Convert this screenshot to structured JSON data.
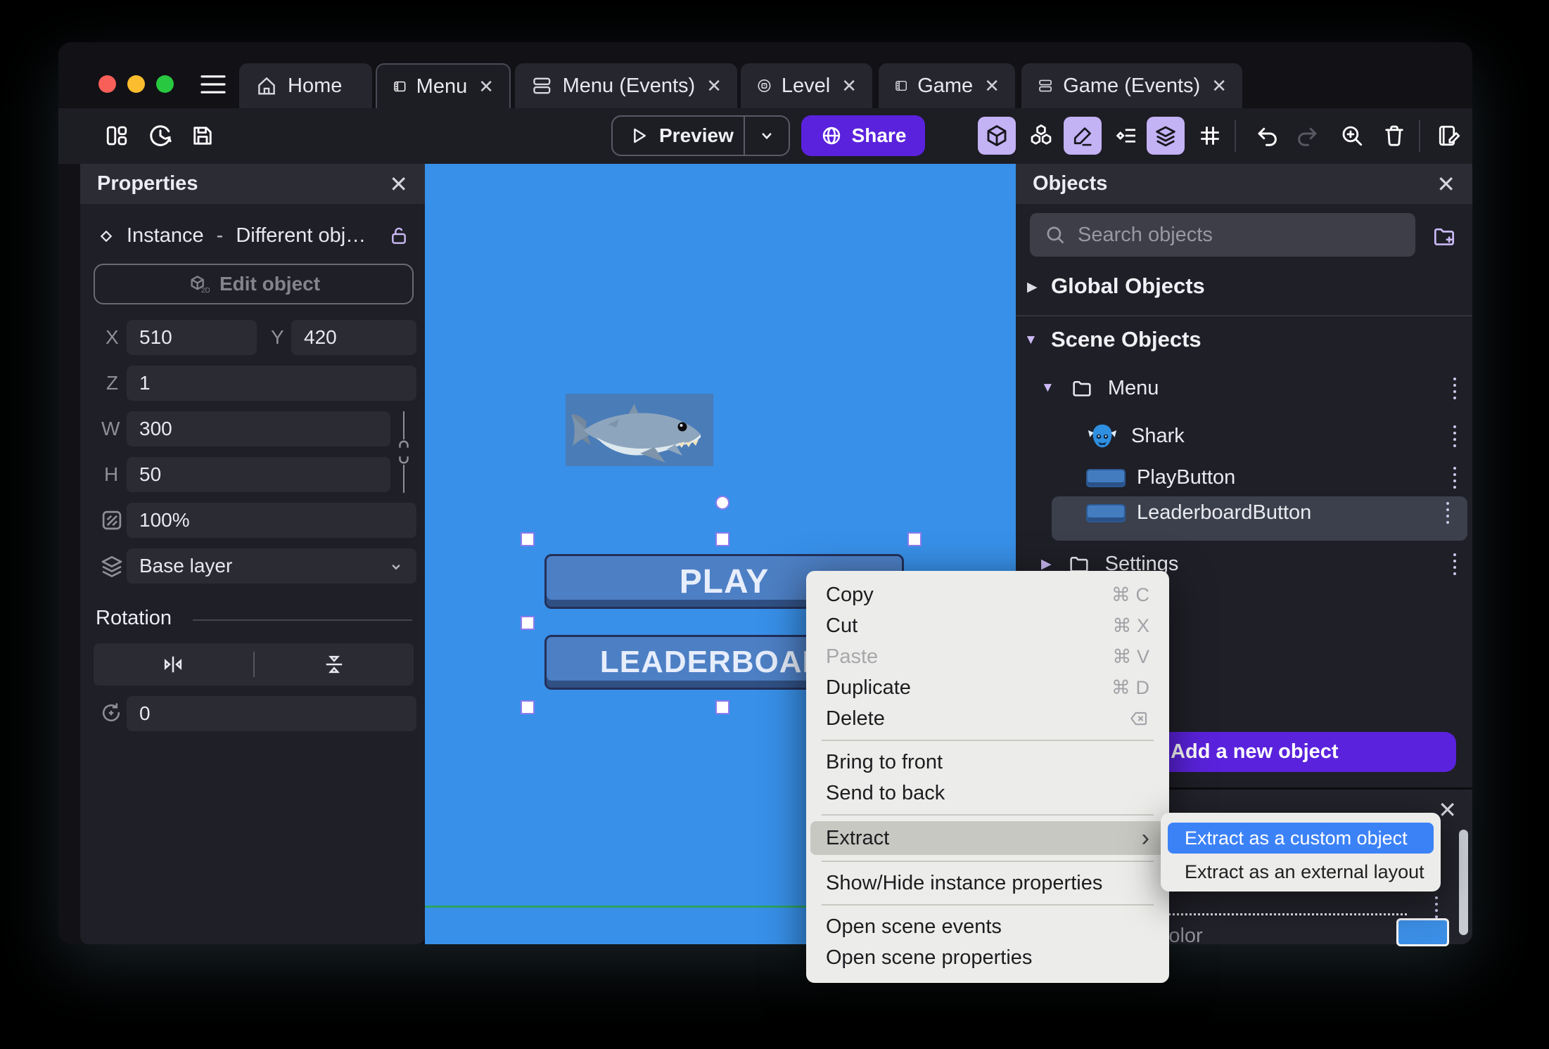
{
  "tabs": [
    {
      "label": "Home",
      "icon": "home",
      "closable": false,
      "active": false
    },
    {
      "label": "Menu",
      "icon": "scene",
      "closable": true,
      "active": true
    },
    {
      "label": "Menu (Events)",
      "icon": "events",
      "closable": true,
      "active": false
    },
    {
      "label": "Level",
      "icon": "external-layout",
      "closable": true,
      "active": false
    },
    {
      "label": "Game",
      "icon": "scene",
      "closable": true,
      "active": false
    },
    {
      "label": "Game (Events)",
      "icon": "events",
      "closable": true,
      "active": false
    }
  ],
  "toolbar": {
    "preview_label": "Preview",
    "share_label": "Share"
  },
  "properties": {
    "title": "Properties",
    "instance_type": "Instance",
    "instance_separator": "-",
    "instance_name": "Different obj…",
    "edit_object": "Edit object",
    "edit_object_icon_label": "2D",
    "x_label": "X",
    "x_value": "510",
    "y_label": "Y",
    "y_value": "420",
    "z_label": "Z",
    "z_value": "1",
    "w_label": "W",
    "w_value": "300",
    "h_label": "H",
    "h_value": "50",
    "opacity_value": "100%",
    "layer_value": "Base layer",
    "rotation_title": "Rotation",
    "rotation_value": "0"
  },
  "canvas": {
    "background": "#3890E8",
    "play_label": "PLAY",
    "leaderboard_label": "LEADERBOARD",
    "button_color": "#4D7FC4",
    "selection_color": "#8F7BEE",
    "guide_color": "#2BA263"
  },
  "objects": {
    "title": "Objects",
    "search_placeholder": "Search objects",
    "global_header": "Global Objects",
    "scene_header": "Scene Objects",
    "tree": [
      {
        "label": "Menu",
        "type": "folder",
        "expanded": true
      },
      {
        "label": "Shark",
        "type": "object",
        "icon": "shark"
      },
      {
        "label": "PlayButton",
        "type": "object",
        "icon": "button"
      },
      {
        "label": "LeaderboardButton",
        "type": "object",
        "icon": "button",
        "selected": true
      },
      {
        "label": "Settings",
        "type": "folder",
        "expanded": false
      }
    ],
    "add_button": "Add a new object"
  },
  "layers_panel": {
    "layer_name": "Base layer",
    "background_color_label": "Background color",
    "swatch_color": "#3C8FE6"
  },
  "context_menu": {
    "items": [
      {
        "label": "Copy",
        "shortcut": "⌘ C"
      },
      {
        "label": "Cut",
        "shortcut": "⌘ X"
      },
      {
        "label": "Paste",
        "shortcut": "⌘ V",
        "disabled": true
      },
      {
        "label": "Duplicate",
        "shortcut": "⌘ D"
      },
      {
        "label": "Delete",
        "shortcut_icon": "delete-key"
      },
      {
        "label": "Bring to front"
      },
      {
        "label": "Send to back"
      },
      {
        "label": "Extract",
        "submenu": true,
        "highlighted": true
      },
      {
        "label": "Show/Hide instance properties"
      },
      {
        "label": "Open scene events"
      },
      {
        "label": "Open scene properties"
      }
    ]
  },
  "submenu": {
    "items": [
      {
        "label": "Extract as a custom object",
        "highlighted": true
      },
      {
        "label": "Extract as an external layout"
      }
    ],
    "highlight_color": "#3C82F7"
  }
}
